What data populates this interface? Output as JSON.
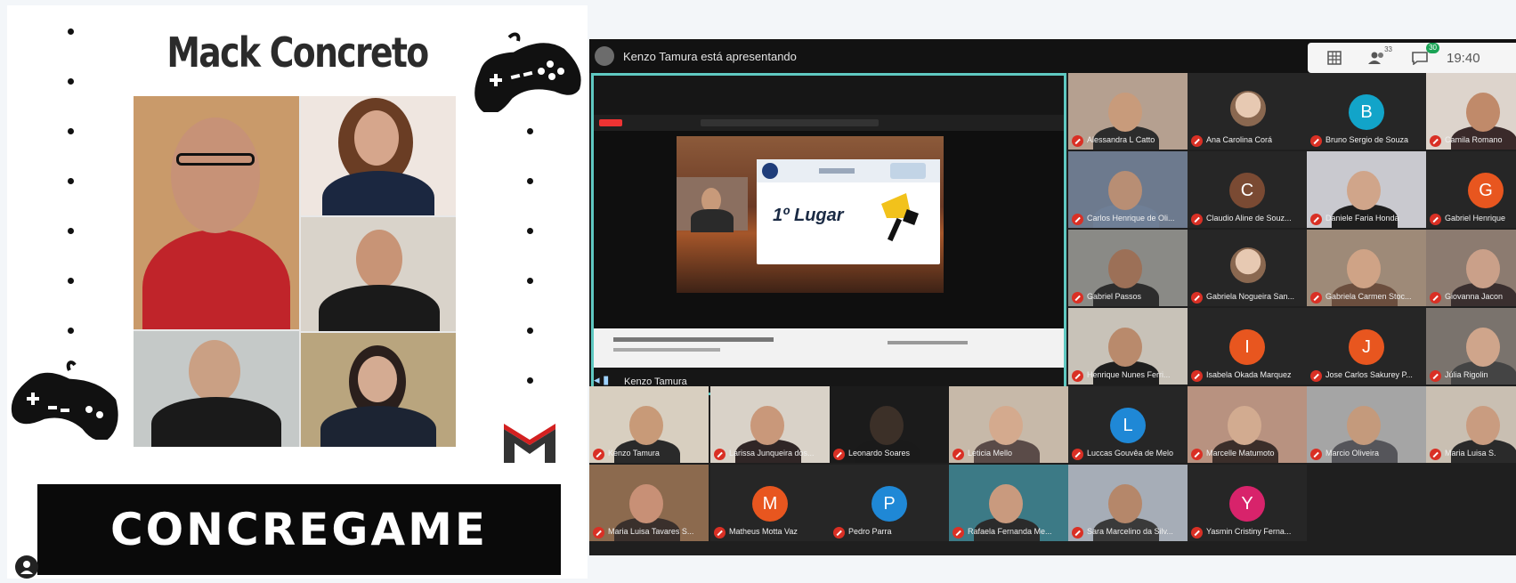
{
  "poster": {
    "title": "Mack Concreto",
    "banner": "CONCREGAME",
    "icons": [
      "gamepad-icon",
      "gamepad-icon",
      "mackenzie-logo",
      "user-icon"
    ]
  },
  "meeting": {
    "presenter_text": "Kenzo Tamura está apresentando",
    "time": "19:40",
    "participants_count": "33",
    "chat_count": "30",
    "share_owner": "Kenzo Tamura",
    "slide_prize": "1º Lugar",
    "participants": [
      {
        "name": "Alessandra L Catto",
        "kind": "video",
        "skin": "#c89b7b",
        "shirt": "#2c2c2c",
        "bg": "#b5a090"
      },
      {
        "name": "Ana Carolina Corá",
        "kind": "photo"
      },
      {
        "name": "Bruno Sergio de Souza",
        "kind": "initial",
        "initial": "B",
        "color": "#12a4c9"
      },
      {
        "name": "Camila Romano",
        "kind": "video",
        "skin": "#c08a6a",
        "shirt": "#3a2a2a",
        "bg": "#ddd4cc"
      },
      {
        "name": "Carlos Henrique de Oli...",
        "kind": "video",
        "skin": "#b88e74",
        "shirt": "#6f7f96",
        "bg": "#6d7a8e"
      },
      {
        "name": "Claudio Aline de Souz...",
        "kind": "initial",
        "initial": "C",
        "color": "#7a4a33"
      },
      {
        "name": "Daniele Faria Honda",
        "kind": "video",
        "skin": "#d0a58a",
        "shirt": "#1e1e1e",
        "bg": "#c9c9cf"
      },
      {
        "name": "Gabriel Henrique",
        "kind": "initial",
        "initial": "G",
        "color": "#e8561f"
      },
      {
        "name": "Gabriel Passos",
        "kind": "video",
        "skin": "#9c7057",
        "shirt": "#2d2d2d",
        "bg": "#8a8a86"
      },
      {
        "name": "Gabriela Nogueira San...",
        "kind": "photo"
      },
      {
        "name": "Gabriela Carmen Stoc...",
        "kind": "video",
        "skin": "#cfa386",
        "shirt": "#6b4e3e",
        "bg": "#9e8a78"
      },
      {
        "name": "Giovanna Jacon",
        "kind": "video",
        "skin": "#caa089",
        "shirt": "#3a2f2f",
        "bg": "#8c7b70"
      },
      {
        "name": "Henrique Nunes Ferri...",
        "kind": "video",
        "skin": "#b98a6c",
        "shirt": "#1e1e1e",
        "bg": "#c8c2b8"
      },
      {
        "name": "Isabela Okada Marquez",
        "kind": "initial",
        "initial": "I",
        "color": "#e8561f"
      },
      {
        "name": "Jose Carlos Sakurey P...",
        "kind": "initial",
        "initial": "J",
        "color": "#e8561f"
      },
      {
        "name": "Júlia Rigolin",
        "kind": "video",
        "skin": "#cfa58b",
        "shirt": "#444444",
        "bg": "#7a736d"
      },
      {
        "name": "Kenzo Tamura",
        "kind": "video",
        "skin": "#c89a78",
        "shirt": "#2a2a2a",
        "bg": "#d8cfc0"
      },
      {
        "name": "Larissa Junqueira dos...",
        "kind": "video",
        "skin": "#c9987a",
        "shirt": "#302626",
        "bg": "#d9d2c8"
      },
      {
        "name": "Leonardo Soares",
        "kind": "video",
        "skin": "#3c3028",
        "shirt": "#1a1a1a",
        "bg": "#1b1b1b"
      },
      {
        "name": "Leticia Mello",
        "kind": "video",
        "skin": "#d4aa8e",
        "shirt": "#5a4b48",
        "bg": "#c7b9a9"
      },
      {
        "name": "Luccas Gouvêa de Melo",
        "kind": "initial",
        "initial": "L",
        "color": "#1f88d6"
      },
      {
        "name": "Marcelle Matumoto",
        "kind": "video",
        "skin": "#d2ab90",
        "shirt": "#3b2e2a",
        "bg": "#b89280"
      },
      {
        "name": "Marcio Oliveira",
        "kind": "video",
        "skin": "#c49a7c",
        "shirt": "#55555a",
        "bg": "#a5a5a5"
      },
      {
        "name": "Maria Luisa S.",
        "kind": "video",
        "skin": "#c99c80",
        "shirt": "#2a2a2a",
        "bg": "#c9bfb2"
      },
      {
        "name": "Maria Luisa Tavares S...",
        "kind": "video",
        "skin": "#c89076",
        "shirt": "#3a302c",
        "bg": "#8c6a4e"
      },
      {
        "name": "Matheus Motta Vaz",
        "kind": "initial",
        "initial": "M",
        "color": "#e8561f"
      },
      {
        "name": "Pedro Parra",
        "kind": "initial",
        "initial": "P",
        "color": "#1f88d6"
      },
      {
        "name": "Rafaela Fernanda Me...",
        "kind": "video",
        "skin": "#c99a7e",
        "shirt": "#2b2b2b",
        "bg": "#3c7a86"
      },
      {
        "name": "Sara Marcelino da Silv...",
        "kind": "video",
        "skin": "#b5876a",
        "shirt": "#3a3a3a",
        "bg": "#a6adb7"
      },
      {
        "name": "Yasmin Cristiny Ferna...",
        "kind": "initial",
        "initial": "Y",
        "color": "#d8236b"
      }
    ]
  }
}
